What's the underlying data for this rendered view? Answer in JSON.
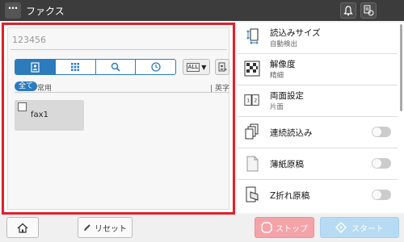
{
  "titlebar": {
    "menu_label": "⋯",
    "title": "ファクス"
  },
  "dest": {
    "placeholder": "123456"
  },
  "tabs": [
    {
      "name": "address-book",
      "active": true
    },
    {
      "name": "direct-input",
      "active": false
    },
    {
      "name": "search",
      "active": false
    },
    {
      "name": "history",
      "active": false
    }
  ],
  "index_dropdown": {
    "label": "ALL"
  },
  "filter": {
    "all": "全て",
    "common": "常用",
    "alpha": "英字"
  },
  "destinations": [
    {
      "name": "fax1",
      "checked": false
    }
  ],
  "settings": [
    {
      "title": "読込みサイズ",
      "sub": "自動検出"
    },
    {
      "title": "解像度",
      "sub": "精細"
    },
    {
      "title": "両面設定",
      "sub": "片面"
    },
    {
      "title": "連続読込み",
      "toggle": false
    },
    {
      "title": "薄紙原稿",
      "toggle": false
    },
    {
      "title": "Z折れ原稿",
      "toggle": false
    }
  ],
  "bottom": {
    "reset": "リセット",
    "stop": "ストップ",
    "start": "スタート"
  },
  "colors": {
    "accent": "#2b7bbd",
    "highlight_border": "#e0202a",
    "stop": "#f4a3a8",
    "start": "#b7dbf3"
  }
}
